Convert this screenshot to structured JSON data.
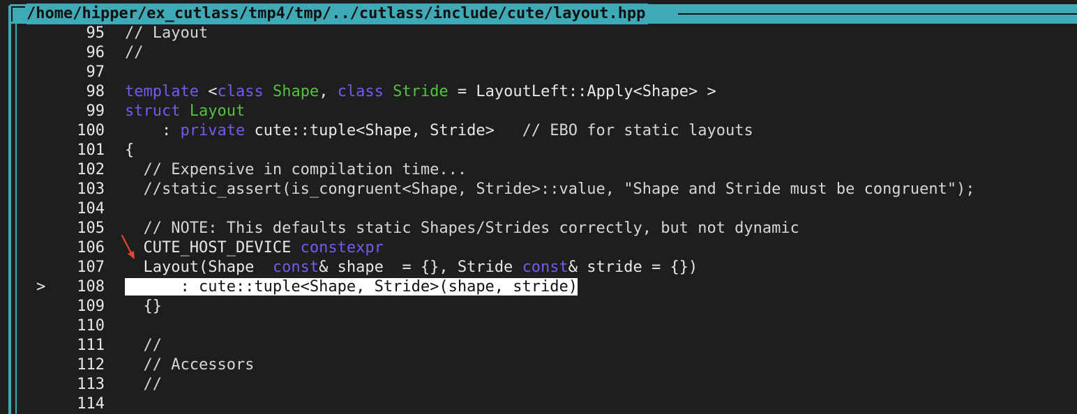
{
  "window": {
    "title": "/home/hipper/ex_cutlass/tmp4/tmp/../cutlass/include/cute/layout.hpp"
  },
  "editor": {
    "current_line_marker": ">",
    "lines": [
      {
        "num": "95",
        "segments": [
          {
            "t": "// Layout",
            "c": "cm"
          }
        ]
      },
      {
        "num": "96",
        "segments": [
          {
            "t": "//",
            "c": "cm"
          }
        ]
      },
      {
        "num": "97",
        "segments": []
      },
      {
        "num": "98",
        "segments": [
          {
            "t": "template",
            "c": "kw"
          },
          {
            "t": " <",
            "c": ""
          },
          {
            "t": "class",
            "c": "kw"
          },
          {
            "t": " ",
            "c": ""
          },
          {
            "t": "Shape",
            "c": "ty"
          },
          {
            "t": ", ",
            "c": ""
          },
          {
            "t": "class",
            "c": "kw"
          },
          {
            "t": " ",
            "c": ""
          },
          {
            "t": "Stride",
            "c": "ty"
          },
          {
            "t": " = LayoutLeft::Apply<Shape> >",
            "c": ""
          }
        ]
      },
      {
        "num": "99",
        "segments": [
          {
            "t": "struct",
            "c": "kw"
          },
          {
            "t": " ",
            "c": ""
          },
          {
            "t": "Layout",
            "c": "ty"
          }
        ]
      },
      {
        "num": "100",
        "segments": [
          {
            "t": "    : ",
            "c": ""
          },
          {
            "t": "private",
            "c": "kw"
          },
          {
            "t": " cute::tuple<Shape, Stride>   ",
            "c": ""
          },
          {
            "t": "// EBO for static layouts",
            "c": "cm"
          }
        ]
      },
      {
        "num": "101",
        "segments": [
          {
            "t": "{",
            "c": ""
          }
        ]
      },
      {
        "num": "102",
        "segments": [
          {
            "t": "  // Expensive in compilation time...",
            "c": "cm"
          }
        ]
      },
      {
        "num": "103",
        "segments": [
          {
            "t": "  //static_assert(is_congruent<Shape, Stride>::value, \"Shape and Stride must be congruent\");",
            "c": "cm"
          }
        ]
      },
      {
        "num": "104",
        "segments": []
      },
      {
        "num": "105",
        "segments": [
          {
            "t": "  // NOTE: This defaults static Shapes/Strides correctly, but not dynamic",
            "c": "cm"
          }
        ]
      },
      {
        "num": "106",
        "segments": [
          {
            "t": "  CUTE_HOST_DEVICE ",
            "c": ""
          },
          {
            "t": "constexpr",
            "c": "kw"
          }
        ]
      },
      {
        "num": "107",
        "segments": [
          {
            "t": "  Layout(Shape  ",
            "c": ""
          },
          {
            "t": "const",
            "c": "kw"
          },
          {
            "t": "& shape  = {}, Stride ",
            "c": ""
          },
          {
            "t": "const",
            "c": "kw"
          },
          {
            "t": "& stride = {})",
            "c": ""
          }
        ]
      },
      {
        "num": "108",
        "current": true,
        "segments": [
          {
            "t": "      : cute::tuple<Shape, Stride>(shape, stride)",
            "c": "hl"
          }
        ]
      },
      {
        "num": "109",
        "segments": [
          {
            "t": "  {}",
            "c": ""
          }
        ]
      },
      {
        "num": "110",
        "segments": []
      },
      {
        "num": "111",
        "segments": [
          {
            "t": "  //",
            "c": "cm"
          }
        ]
      },
      {
        "num": "112",
        "segments": [
          {
            "t": "  // Accessors",
            "c": "cm"
          }
        ]
      },
      {
        "num": "113",
        "segments": [
          {
            "t": "  //",
            "c": "cm"
          }
        ]
      },
      {
        "num": "114",
        "segments": []
      }
    ]
  },
  "colors": {
    "frame": "#3fa9b5",
    "keyword": "#6f5cf0",
    "type": "#52c23f",
    "annotation_arrow": "#e8452c"
  },
  "annotation": {
    "icon": "red-arrow-icon"
  }
}
